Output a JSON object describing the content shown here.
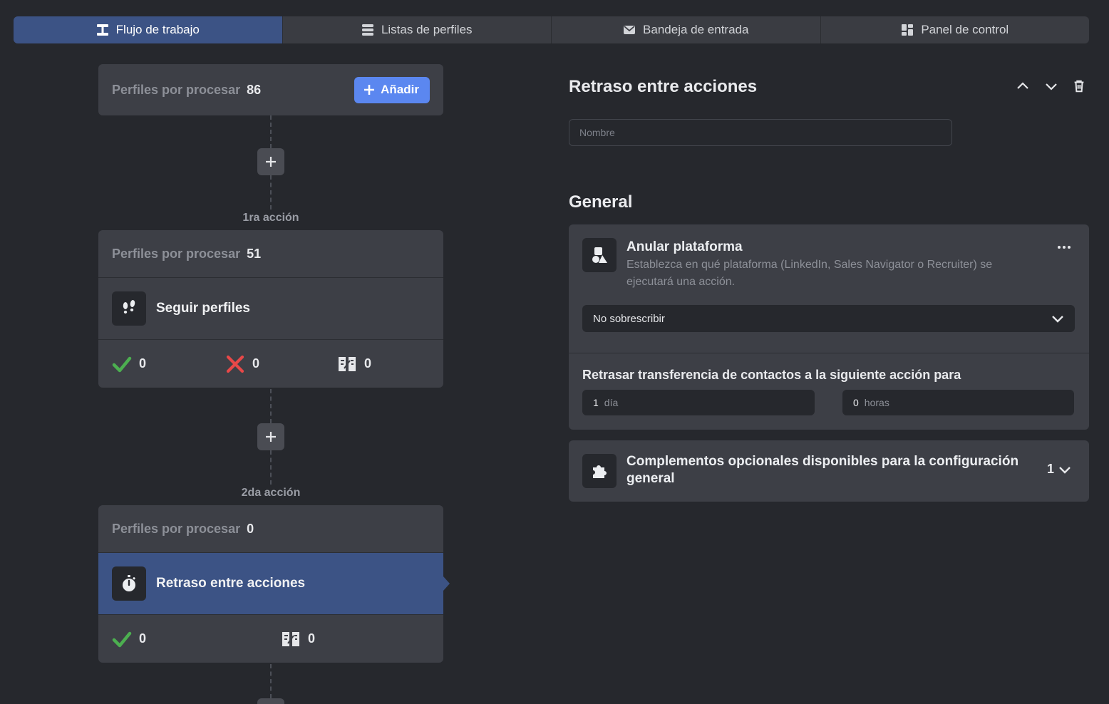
{
  "tabs": [
    {
      "label": "Flujo de trabajo",
      "icon": "workflow-icon",
      "active": true
    },
    {
      "label": "Listas de perfiles",
      "icon": "list-icon",
      "active": false
    },
    {
      "label": "Bandeja de entrada",
      "icon": "envelope-icon",
      "active": false
    },
    {
      "label": "Panel de control",
      "icon": "dashboard-icon",
      "active": false
    }
  ],
  "workflow": {
    "start": {
      "label": "Perfiles por procesar",
      "count": "86",
      "add_label": "Añadir"
    },
    "steps": [
      {
        "step_label": "1ra acción",
        "pending_label": "Perfiles por procesar",
        "pending_count": "51",
        "action_name": "Seguir perfiles",
        "action_icon": "footsteps-icon",
        "success": "0",
        "failed": "0",
        "skipped": "0"
      },
      {
        "step_label": "2da acción",
        "pending_label": "Perfiles por procesar",
        "pending_count": "0",
        "action_name": "Retraso entre acciones",
        "action_icon": "stopwatch-icon",
        "success": "0",
        "skipped": "0"
      }
    ]
  },
  "panel": {
    "title": "Retraso entre acciones",
    "name_placeholder": "Nombre",
    "section_title": "General",
    "platform": {
      "heading": "Anular plataforma",
      "description": "Establezca en qué plataforma (LinkedIn, Sales Navigator o Recruiter) se ejecutará una acción.",
      "selected_option": "No sobrescribir"
    },
    "delay": {
      "label": "Retrasar transferencia de contactos a la siguiente acción para",
      "days_value": "1",
      "days_unit": "día",
      "hours_value": "0",
      "hours_unit": "horas"
    },
    "addons": {
      "label": "Complementos opcionales disponibles para la configuración general",
      "count": "1"
    }
  },
  "colors": {
    "accent": "#5b87f0",
    "selected": "#3c5385",
    "success": "#4caf50",
    "error": "#e84848",
    "background": "#26282d",
    "card": "#3d3f46"
  }
}
